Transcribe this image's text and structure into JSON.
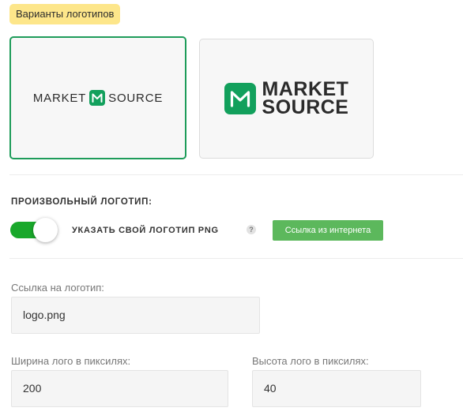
{
  "logos": {
    "heading": "Варианты логотипов",
    "horizontal": {
      "left_word": "MARKET",
      "right_word": "SOURCE",
      "icon": "m-letter-icon"
    },
    "stacked": {
      "line1": "MARKET",
      "line2": "SOURCE",
      "icon": "m-letter-icon"
    }
  },
  "custom_logo": {
    "title": "ПРОИЗВОЛЬНЫЙ ЛОГОТИП:",
    "toggle_label": "УКАЗАТЬ СВОЙ ЛОГОТИП PNG",
    "toggle_on": true,
    "help_symbol": "?",
    "url_button": "Ссылка из интернета"
  },
  "fields": {
    "link_label": "Ссылка на логотип:",
    "link_value": "logo.png",
    "width_label": "Ширина лого в пиксилях:",
    "width_value": "200",
    "height_label": "Высота лого в пиксилях:",
    "height_value": "40"
  },
  "colors": {
    "brand_green": "#12a05c",
    "toggle_green": "#19a82b",
    "button_green": "#5cb85c",
    "badge_yellow": "#fde68a"
  }
}
